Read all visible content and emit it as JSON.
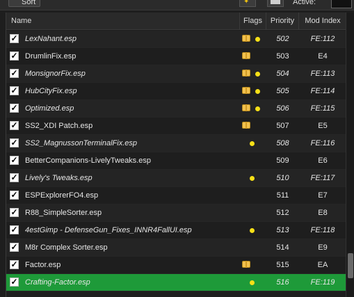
{
  "toolbar": {
    "sort_label": "Sort",
    "active_label": "Active:"
  },
  "columns": {
    "name": "Name",
    "flags": "Flags",
    "priority": "Priority",
    "mod_index": "Mod Index"
  },
  "plugins": [
    {
      "name": "LexNahant.esp",
      "priority": "502",
      "mod_index": "FE:112",
      "italic": true,
      "package_flag": true,
      "dot_flag": true,
      "checked": true,
      "selected": false
    },
    {
      "name": "DrumlinFix.esp",
      "priority": "503",
      "mod_index": "E4",
      "italic": false,
      "package_flag": true,
      "dot_flag": false,
      "checked": true,
      "selected": false
    },
    {
      "name": "MonsignorFix.esp",
      "priority": "504",
      "mod_index": "FE:113",
      "italic": true,
      "package_flag": true,
      "dot_flag": true,
      "checked": true,
      "selected": false
    },
    {
      "name": "HubCityFix.esp",
      "priority": "505",
      "mod_index": "FE:114",
      "italic": true,
      "package_flag": true,
      "dot_flag": true,
      "checked": true,
      "selected": false
    },
    {
      "name": "Optimized.esp",
      "priority": "506",
      "mod_index": "FE:115",
      "italic": true,
      "package_flag": true,
      "dot_flag": true,
      "checked": true,
      "selected": false
    },
    {
      "name": "SS2_XDI Patch.esp",
      "priority": "507",
      "mod_index": "E5",
      "italic": false,
      "package_flag": true,
      "dot_flag": false,
      "checked": true,
      "selected": false
    },
    {
      "name": "SS2_MagnussonTerminalFix.esp",
      "priority": "508",
      "mod_index": "FE:116",
      "italic": true,
      "package_flag": false,
      "dot_flag": true,
      "checked": true,
      "selected": false
    },
    {
      "name": "BetterCompanions-LivelyTweaks.esp",
      "priority": "509",
      "mod_index": "E6",
      "italic": false,
      "package_flag": false,
      "dot_flag": false,
      "checked": true,
      "selected": false
    },
    {
      "name": "Lively's Tweaks.esp",
      "priority": "510",
      "mod_index": "FE:117",
      "italic": true,
      "package_flag": false,
      "dot_flag": true,
      "checked": true,
      "selected": false
    },
    {
      "name": "ESPExplorerFO4.esp",
      "priority": "511",
      "mod_index": "E7",
      "italic": false,
      "package_flag": false,
      "dot_flag": false,
      "checked": true,
      "selected": false
    },
    {
      "name": "R88_SimpleSorter.esp",
      "priority": "512",
      "mod_index": "E8",
      "italic": false,
      "package_flag": false,
      "dot_flag": false,
      "checked": true,
      "selected": false
    },
    {
      "name": "4estGimp - DefenseGun_Fixes_INNR4FallUI.esp",
      "priority": "513",
      "mod_index": "FE:118",
      "italic": true,
      "package_flag": false,
      "dot_flag": true,
      "checked": true,
      "selected": false
    },
    {
      "name": "M8r Complex Sorter.esp",
      "priority": "514",
      "mod_index": "E9",
      "italic": false,
      "package_flag": false,
      "dot_flag": false,
      "checked": true,
      "selected": false
    },
    {
      "name": "Factor.esp",
      "priority": "515",
      "mod_index": "EA",
      "italic": false,
      "package_flag": true,
      "dot_flag": false,
      "checked": true,
      "selected": false
    },
    {
      "name": "Crafting-Factor.esp",
      "priority": "516",
      "mod_index": "FE:119",
      "italic": true,
      "package_flag": false,
      "dot_flag": true,
      "checked": true,
      "selected": true
    }
  ],
  "colors": {
    "background": "#1e1e1e",
    "selected_row": "#1e9a39",
    "flag_dot": "#f7e017",
    "flag_package": "#f2c14e"
  },
  "icons": {
    "package_flag": "package-icon",
    "dot_flag": "light-plugin-dot-icon",
    "checkbox": "checkmark-icon"
  }
}
